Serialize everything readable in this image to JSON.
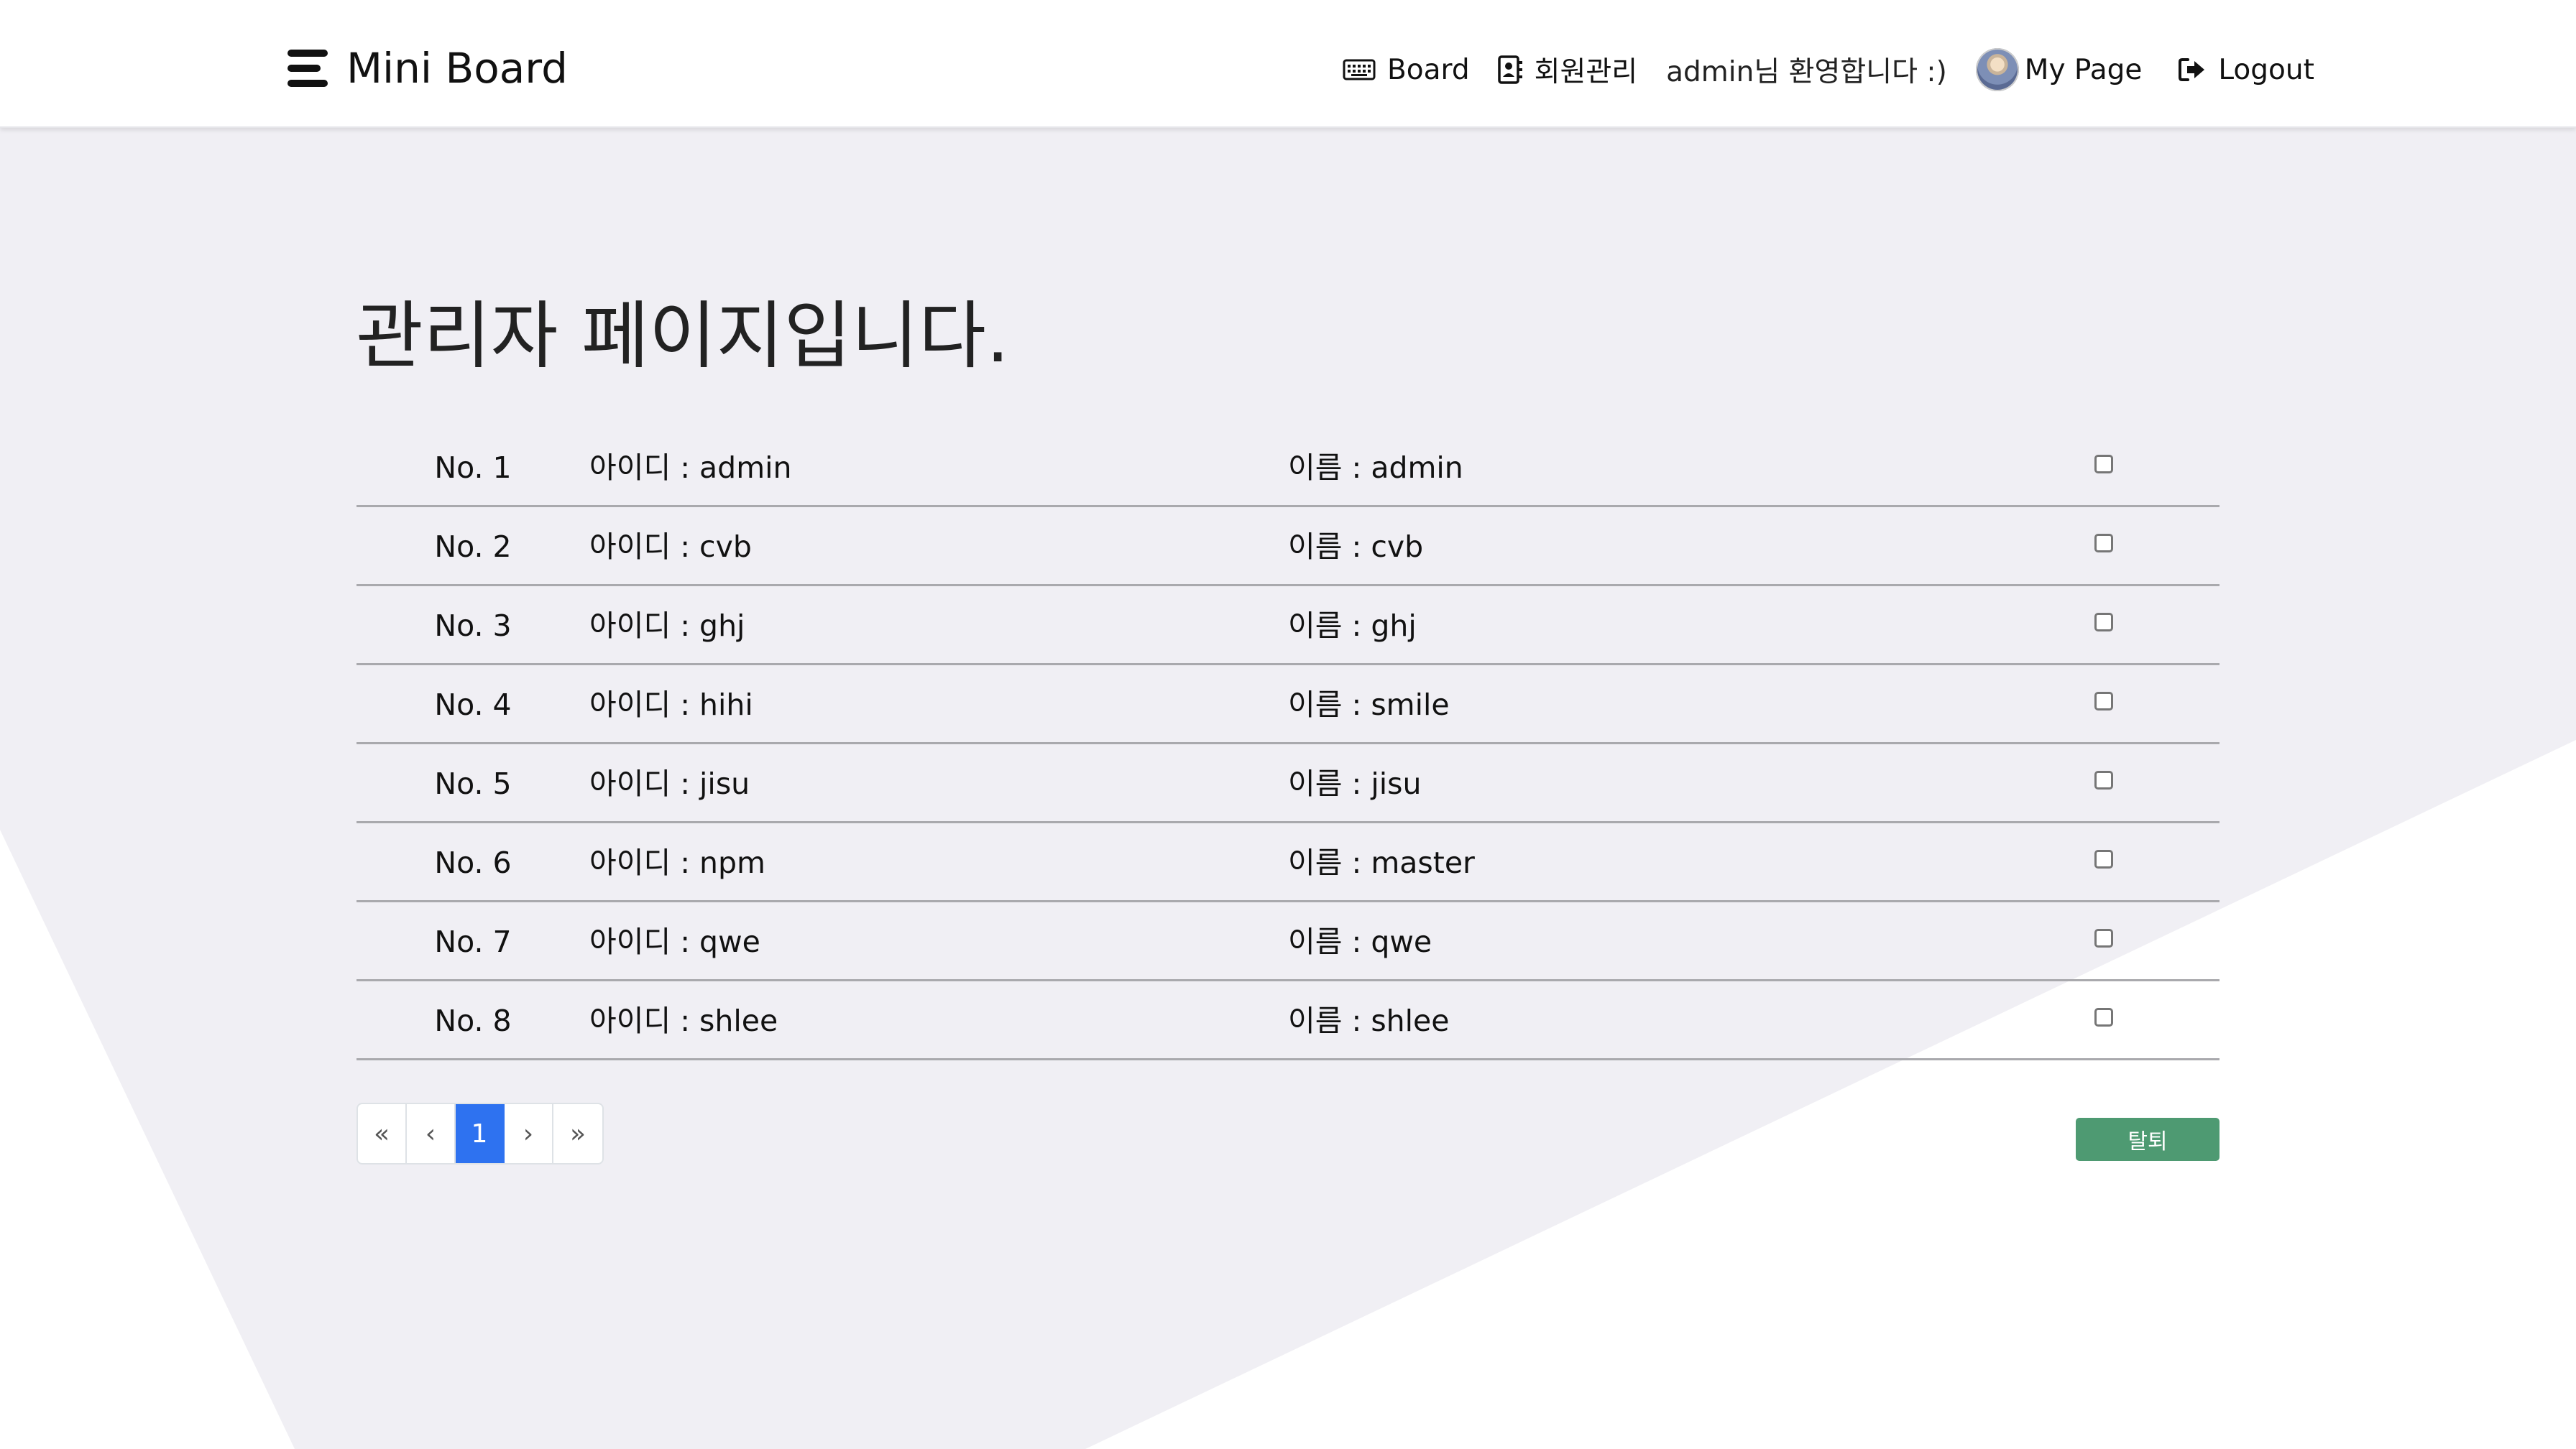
{
  "colors": {
    "background_shape": "#f0eff4",
    "accent": "#2e72f0",
    "withdraw": "#4e9a72"
  },
  "navbar": {
    "brand": "Mini Board",
    "brand_icon": "menu-lines-icon",
    "board_label": "Board",
    "board_icon": "keyboard-icon",
    "members_label": "회원관리",
    "members_icon": "contact-card-icon",
    "welcome": "admin님 환영합니다 :)",
    "mypage_label": "My Page",
    "logout_label": "Logout",
    "logout_icon": "sign-out-icon"
  },
  "page": {
    "title": "관리자 페이지입니다."
  },
  "members": [
    {
      "no": "No. 1",
      "id": "아이디 : admin",
      "name": "이름 : admin"
    },
    {
      "no": "No. 2",
      "id": "아이디 : cvb",
      "name": "이름 : cvb"
    },
    {
      "no": "No. 3",
      "id": "아이디 : ghj",
      "name": "이름 : ghj"
    },
    {
      "no": "No. 4",
      "id": "아이디 : hihi",
      "name": "이름 : smile"
    },
    {
      "no": "No. 5",
      "id": "아이디 : jisu",
      "name": "이름 : jisu"
    },
    {
      "no": "No. 6",
      "id": "아이디 : npm",
      "name": "이름 : master"
    },
    {
      "no": "No. 7",
      "id": "아이디 : qwe",
      "name": "이름 : qwe"
    },
    {
      "no": "No. 8",
      "id": "아이디 : shlee",
      "name": "이름 : shlee"
    }
  ],
  "pagination": {
    "first": "«",
    "prev": "‹",
    "current": "1",
    "next": "›",
    "last": "»"
  },
  "actions": {
    "withdraw": "탈퇴"
  }
}
